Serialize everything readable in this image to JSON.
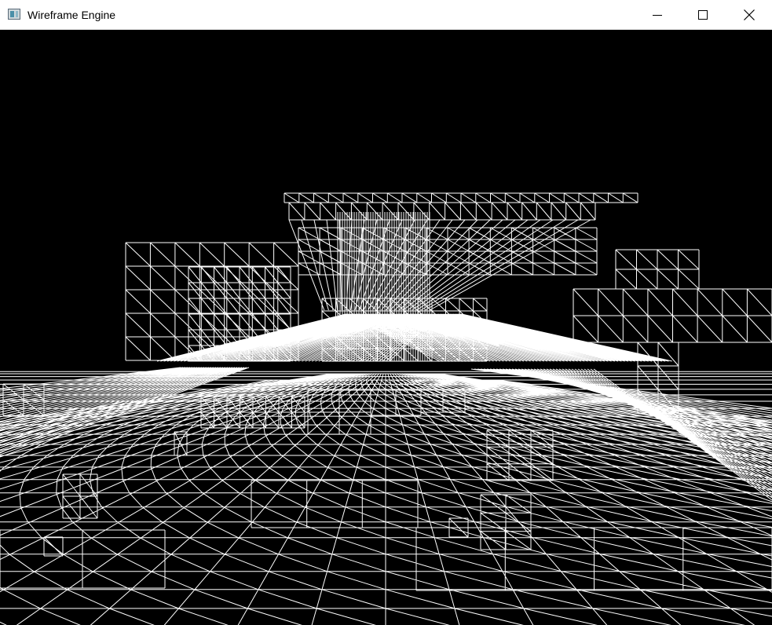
{
  "window": {
    "title": "Wireframe Engine",
    "controls": {
      "minimize_icon": "minimize-icon",
      "maximize_icon": "maximize-icon",
      "close_icon": "close-icon"
    }
  },
  "viewport": {
    "background_color": "#000000",
    "line_color": "#ffffff"
  }
}
